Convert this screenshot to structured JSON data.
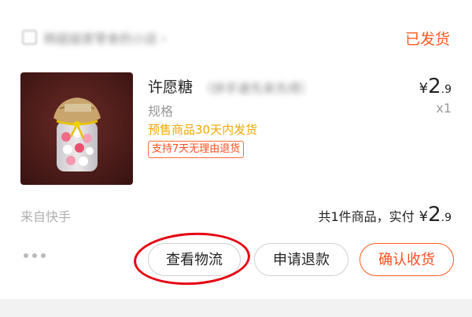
{
  "shop": {
    "name": "韩姐姐家零食的小店",
    "arrow": "›",
    "icon": "shop-icon"
  },
  "order": {
    "status": "已发货",
    "source": "来自快手"
  },
  "product": {
    "name": "许愿糖",
    "name_suffix": "（拼手速先来先得）",
    "price_symbol": "¥",
    "price_int": "2",
    "price_dec": ".9",
    "spec_label": "规格",
    "quantity": "x1",
    "presale_note": "预售商品30天内发货",
    "return_badge": "支持7天无理由退货"
  },
  "summary": {
    "text": "共1件商品，实付",
    "price_symbol": "¥",
    "price_int": "2",
    "price_dec": ".9"
  },
  "actions": {
    "more_icon": "more-dots-icon",
    "logistics": "查看物流",
    "refund": "申请退款",
    "confirm": "确认收货"
  },
  "colors": {
    "accent": "#ff5a1f",
    "presale": "#f0a800",
    "highlight_circle": "#e60012"
  }
}
